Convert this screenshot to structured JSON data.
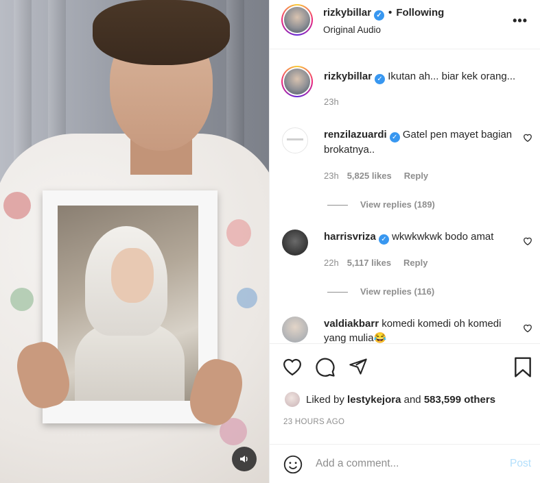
{
  "post": {
    "username": "rizkybillar",
    "following_label": "Following",
    "audio_label": "Original Audio",
    "more_label": "•••"
  },
  "comments": [
    {
      "user": "rizkybillar",
      "verified": true,
      "text": "Ikutan ah... biar kek orang...",
      "time": "23h"
    },
    {
      "user": "renzilazuardi",
      "verified": true,
      "text": "Gatel pen mayet bagian brokatnya..",
      "time": "23h",
      "likes": "5,825 likes",
      "reply_label": "Reply",
      "view_replies": "View replies (189)"
    },
    {
      "user": "harrisvriza",
      "verified": true,
      "text": "wkwkwkwk bodo amat",
      "time": "22h",
      "likes": "5,117 likes",
      "reply_label": "Reply",
      "view_replies": "View replies (116)"
    },
    {
      "user": "valdiakbarr",
      "verified": false,
      "text": "komedi komedi oh komedi yang mulia😂",
      "time": "",
      "likes": "",
      "reply_label": ""
    }
  ],
  "likes_bar": {
    "prefix": "Liked by",
    "user": "lestykejora",
    "middle": "and",
    "others": "583,599 others"
  },
  "timestamp": "23 HOURS AGO",
  "comment_box": {
    "placeholder": "Add a comment...",
    "post_label": "Post"
  },
  "colors": {
    "verified": "#3897f0",
    "post_disabled": "#b2dffc",
    "muted": "#8e8e8e"
  },
  "icons": [
    "volume-icon",
    "more-icon",
    "heart-icon",
    "comment-icon",
    "share-icon",
    "bookmark-icon",
    "emoji-icon"
  ]
}
